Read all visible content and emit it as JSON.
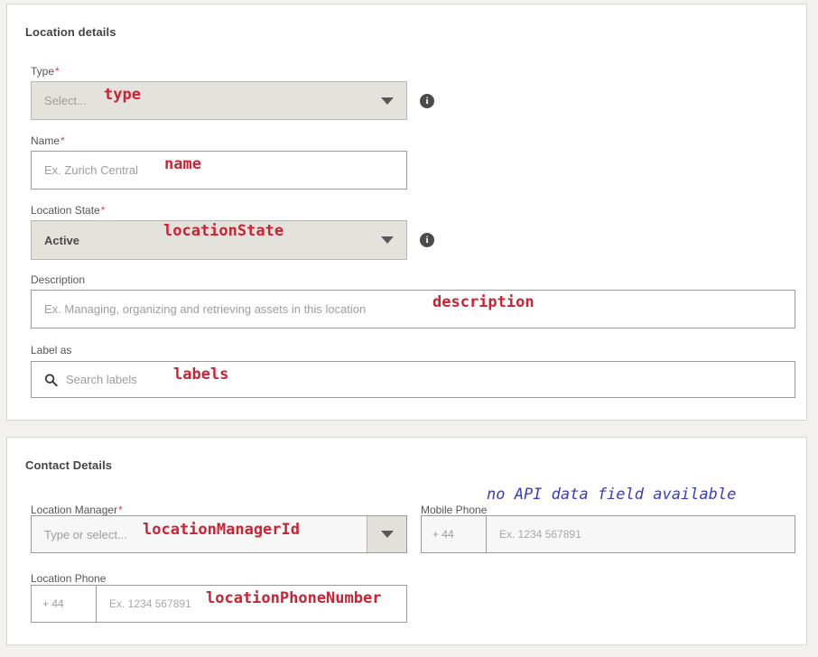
{
  "panels": {
    "location": {
      "title": "Location details",
      "fields": {
        "type": {
          "label": "Type",
          "required": "*",
          "placeholder": "Select...",
          "info_icon": "info-icon",
          "caret_icon": "chevron-down-icon",
          "annotation": "type"
        },
        "name": {
          "label": "Name",
          "required": "*",
          "placeholder": "Ex. Zurich Central",
          "annotation": "name"
        },
        "location_state": {
          "label": "Location State",
          "required": "*",
          "value": "Active",
          "info_icon": "info-icon",
          "caret_icon": "chevron-down-icon",
          "annotation": "locationState"
        },
        "description": {
          "label": "Description",
          "placeholder": "Ex. Managing, organizing and retrieving assets in this location",
          "annotation": "description"
        },
        "label_as": {
          "label": "Label as",
          "placeholder": "Search labels",
          "search_icon": "search-icon",
          "annotation": "labels"
        }
      }
    },
    "contact": {
      "title": "Contact Details",
      "fields": {
        "location_manager": {
          "label": "Location Manager",
          "required": "*",
          "placeholder": "Type or select...",
          "caret_icon": "chevron-down-icon",
          "annotation": "locationManagerId"
        },
        "mobile_phone": {
          "label": "Mobile Phone",
          "prefix": "+ 44",
          "placeholder": "Ex. 1234 567891",
          "annotation": "no API data field available"
        },
        "location_phone": {
          "label": "Location Phone",
          "prefix": "+ 44",
          "placeholder": "Ex. 1234 567891",
          "annotation": "locationPhoneNumber"
        }
      }
    }
  },
  "colors": {
    "annotation_red": "#cc2233",
    "annotation_blue": "#3b3bbf",
    "required_red": "#d1495b",
    "panel_bg": "#ffffff",
    "page_bg": "#f2f1ef",
    "control_gray": "#e4e2dd"
  }
}
